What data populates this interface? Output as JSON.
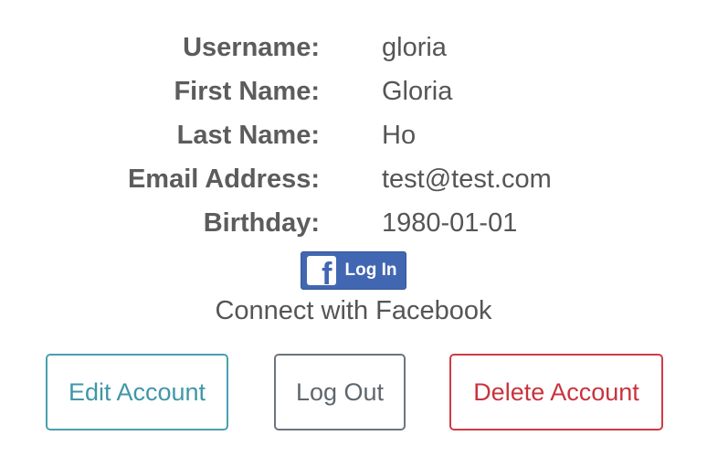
{
  "profile": {
    "fields": [
      {
        "label": "Username:",
        "value": "gloria"
      },
      {
        "label": "First Name:",
        "value": "Gloria"
      },
      {
        "label": "Last Name:",
        "value": "Ho"
      },
      {
        "label": "Email Address:",
        "value": "test@test.com"
      },
      {
        "label": "Birthday:",
        "value": "1980-01-01"
      }
    ]
  },
  "facebook": {
    "icon": "facebook-f-icon",
    "icon_glyph": "f",
    "button_label": "Log In",
    "connect_text": "Connect with Facebook",
    "brand_color": "#4267b2"
  },
  "actions": {
    "edit_label": "Edit Account",
    "logout_label": "Log Out",
    "delete_label": "Delete Account",
    "edit_color": "#4a9fb0",
    "logout_color": "#6c757d",
    "delete_color": "#cf3b45"
  }
}
